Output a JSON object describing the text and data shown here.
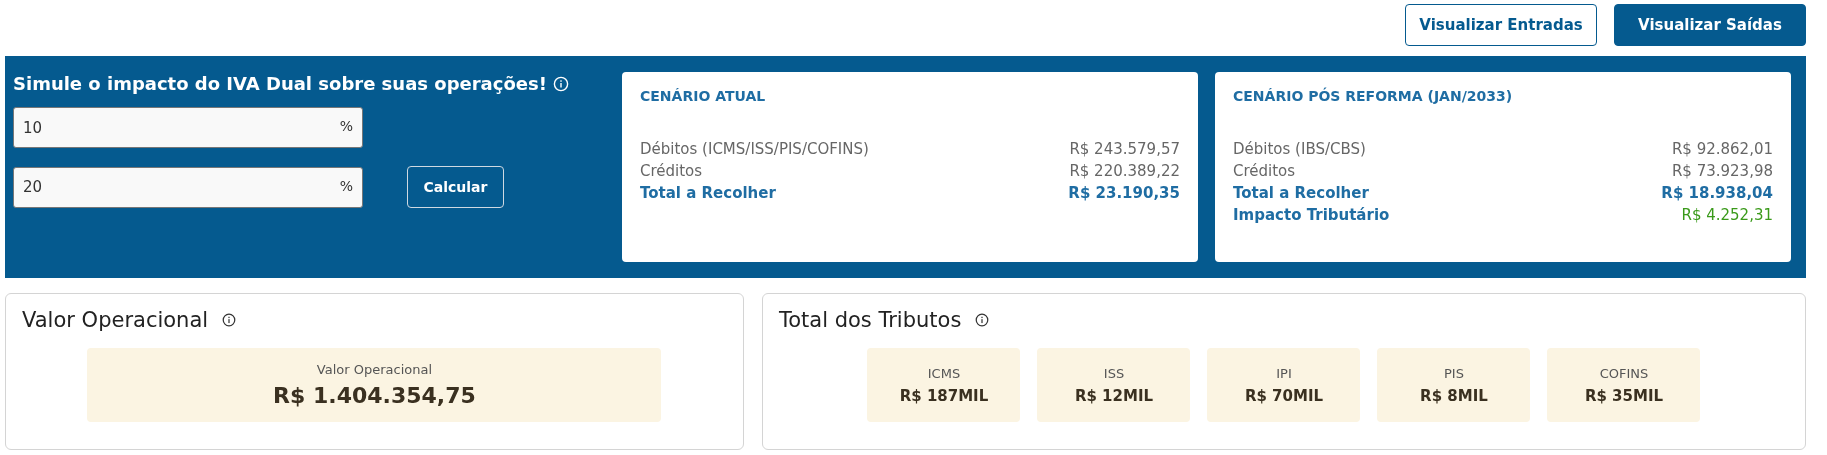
{
  "view_buttons": [
    {
      "label": "Visualizar Entradas",
      "selected": false
    },
    {
      "label": "Visualizar Saídas",
      "selected": true
    }
  ],
  "simulator": {
    "title": "Simule o impacto do IVA Dual sobre suas operações!",
    "fields": [
      {
        "value": "10",
        "unit": "%"
      },
      {
        "value": "20",
        "unit": "%"
      }
    ],
    "button": "Calcular"
  },
  "scenarios": [
    {
      "title": "CENÁRIO ATUAL",
      "rows": [
        {
          "kind": "normal",
          "label": "Débitos (ICMS/ISS/PIS/COFINS)",
          "value": "R$ 243.579,57"
        },
        {
          "kind": "normal",
          "label": "Créditos",
          "value": "R$ 220.389,22"
        },
        {
          "kind": "total",
          "label": "Total a Recolher",
          "value": "R$ 23.190,35"
        }
      ]
    },
    {
      "title": "CENÁRIO PÓS REFORMA (JAN/2033)",
      "rows": [
        {
          "kind": "normal",
          "label": "Débitos (IBS/CBS)",
          "value": "R$ 92.862,01"
        },
        {
          "kind": "normal",
          "label": "Créditos",
          "value": "R$ 73.923,98"
        },
        {
          "kind": "total",
          "label": "Total a Recolher",
          "value": "R$ 18.938,04"
        },
        {
          "kind": "impact",
          "label": "Impacto Tributário",
          "value": "R$ 4.252,31"
        }
      ]
    }
  ],
  "operational": {
    "title": "Valor Operacional",
    "tile": {
      "label": "Valor Operacional",
      "value": "R$ 1.404.354,75"
    }
  },
  "taxes": {
    "title": "Total dos Tributos",
    "tiles": [
      {
        "label": "ICMS",
        "value": "R$ 187MIL"
      },
      {
        "label": "ISS",
        "value": "R$ 12MIL"
      },
      {
        "label": "IPI",
        "value": "R$ 70MIL"
      },
      {
        "label": "PIS",
        "value": "R$ 8MIL"
      },
      {
        "label": "COFINS",
        "value": "R$ 35MIL"
      }
    ]
  }
}
